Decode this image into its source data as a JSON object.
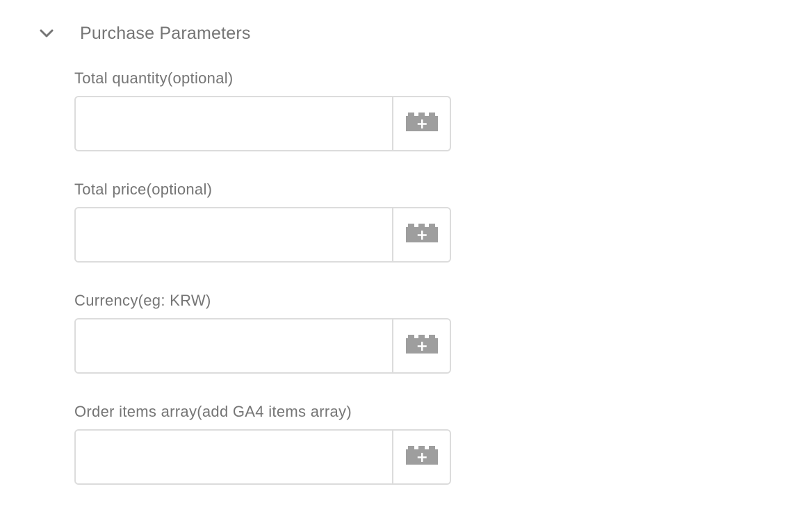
{
  "section": {
    "title": "Purchase Parameters",
    "expanded": true,
    "chevron_icon": "chevron-down-icon"
  },
  "fields": [
    {
      "label": "Total quantity(optional)",
      "value": "",
      "button_icon": "add-variable-brick-icon"
    },
    {
      "label": "Total price(optional)",
      "value": "",
      "button_icon": "add-variable-brick-icon"
    },
    {
      "label": "Currency(eg: KRW)",
      "value": "",
      "button_icon": "add-variable-brick-icon"
    },
    {
      "label": "Order items array(add GA4 items array)",
      "value": "",
      "button_icon": "add-variable-brick-icon"
    }
  ],
  "colors": {
    "text": "#757575",
    "border": "#dcdcdc",
    "icon": "#9e9e9e"
  }
}
